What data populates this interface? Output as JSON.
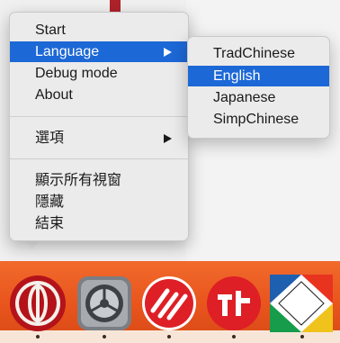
{
  "context_menu": {
    "items": [
      {
        "label": "Start"
      },
      {
        "label": "Language"
      },
      {
        "label": "Debug mode"
      },
      {
        "label": "About"
      },
      {
        "label": "選項"
      },
      {
        "label": "顯示所有視窗"
      },
      {
        "label": "隱藏"
      },
      {
        "label": "結束"
      }
    ]
  },
  "language_submenu": {
    "items": [
      {
        "label": "TradChinese"
      },
      {
        "label": "English"
      },
      {
        "label": "Japanese"
      },
      {
        "label": "SimpChinese"
      }
    ],
    "selected": "English"
  },
  "dock": {
    "apps": [
      {
        "icon": "app-logo-icon"
      },
      {
        "icon": "system-preferences-icon"
      },
      {
        "icon": "red-s-logo-icon"
      },
      {
        "icon": "red-jt-logo-icon"
      },
      {
        "icon": "color-flag-icon"
      }
    ]
  },
  "colors": {
    "highlight": "#1c68d6",
    "menu_background": "#ebebeb",
    "dock_orange": "#ee6225"
  }
}
